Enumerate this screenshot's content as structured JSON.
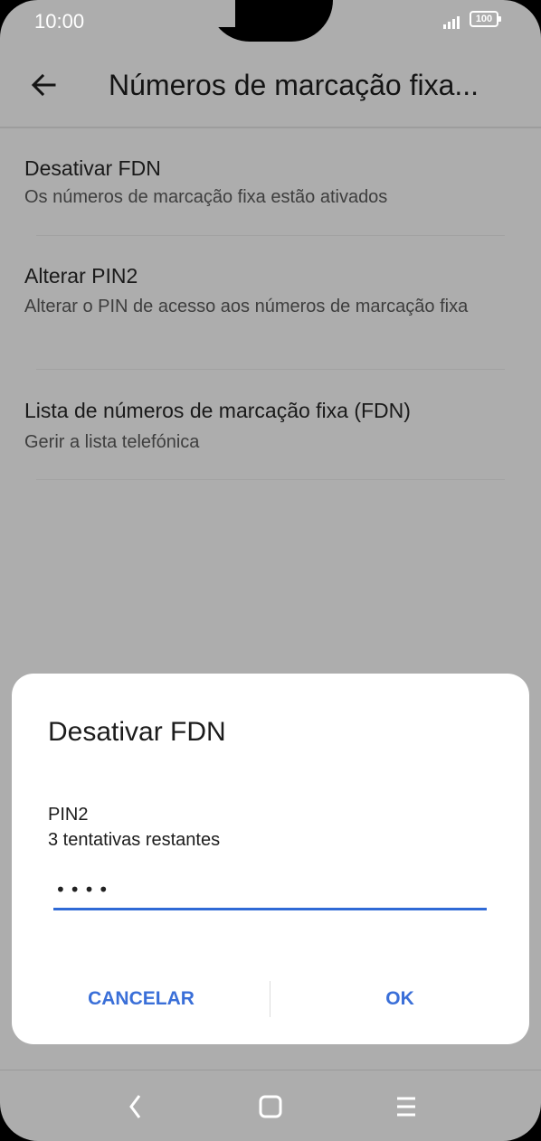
{
  "status_bar": {
    "time": "10:00",
    "battery": "100"
  },
  "app_bar": {
    "title": "Números de marcação fixa..."
  },
  "settings": [
    {
      "title": "Desativar FDN",
      "subtitle": "Os números de marcação fixa estão ativados"
    },
    {
      "title": "Alterar PIN2",
      "subtitle": "Alterar o PIN de acesso aos números de marcação fixa"
    },
    {
      "title": "Lista de números de marcação fixa (FDN)",
      "subtitle": "Gerir a lista telefónica"
    }
  ],
  "dialog": {
    "title": "Desativar FDN",
    "field_label": "PIN2",
    "field_hint": "3 tentativas restantes",
    "pin_value": "••••",
    "cancel_label": "CANCELAR",
    "ok_label": "OK"
  },
  "colors": {
    "accent": "#3a6fd8",
    "scrim": "#adadad",
    "dialog_bg": "#ffffff"
  },
  "icons": [
    "back-arrow-icon",
    "signal-icon",
    "battery-icon",
    "nav-back-icon",
    "nav-home-icon",
    "nav-menu-icon"
  ]
}
